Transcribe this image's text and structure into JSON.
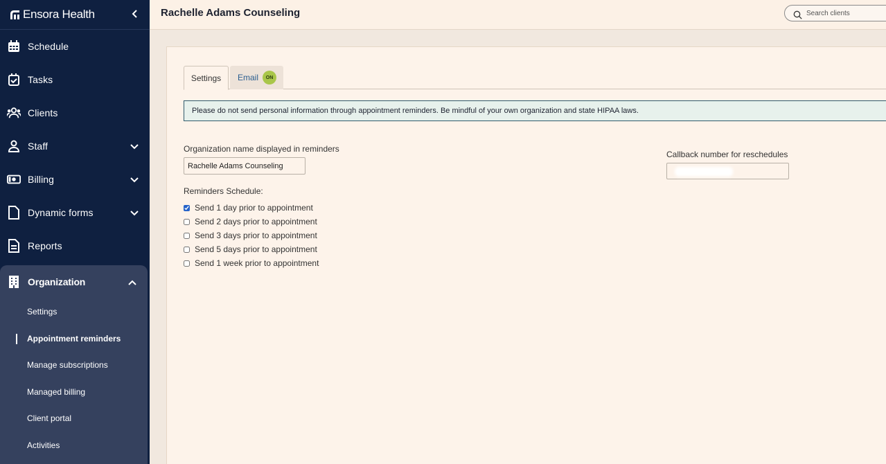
{
  "brand": {
    "name": "Ensora Health"
  },
  "nav": {
    "items": [
      {
        "label": "Schedule",
        "icon": "calendar-icon",
        "has_chevron": false
      },
      {
        "label": "Tasks",
        "icon": "task-check-icon",
        "has_chevron": false
      },
      {
        "label": "Clients",
        "icon": "clients-icon",
        "has_chevron": false
      },
      {
        "label": "Staff",
        "icon": "staff-icon",
        "has_chevron": true
      },
      {
        "label": "Billing",
        "icon": "billing-icon",
        "has_chevron": true
      },
      {
        "label": "Dynamic forms",
        "icon": "form-icon",
        "has_chevron": true
      },
      {
        "label": "Reports",
        "icon": "report-icon",
        "has_chevron": false
      }
    ],
    "organization": {
      "label": "Organization",
      "icon": "building-icon",
      "expanded": true,
      "sub_items": [
        {
          "label": "Settings",
          "active": false
        },
        {
          "label": "Appointment reminders",
          "active": true
        },
        {
          "label": "Manage subscriptions",
          "active": false
        },
        {
          "label": "Managed billing",
          "active": false
        },
        {
          "label": "Client portal",
          "active": false
        },
        {
          "label": "Activities",
          "active": false
        }
      ]
    }
  },
  "header": {
    "title": "Rachelle Adams Counseling",
    "search_placeholder": "Search clients"
  },
  "tabs": {
    "settings": "Settings",
    "email": "Email",
    "email_badge": "ON"
  },
  "notice": "Please do not send personal information through appointment reminders. Be mindful of your own organization and state HIPAA laws.",
  "form": {
    "org_name_label": "Organization name displayed in reminders",
    "org_name_value": "Rachelle Adams Counseling",
    "callback_label": "Callback number for reschedules",
    "callback_value": "",
    "schedule_label": "Reminders Schedule:",
    "schedule_options": [
      {
        "label": "Send 1 day prior to appointment",
        "checked": true
      },
      {
        "label": "Send 2 days prior to appointment",
        "checked": false
      },
      {
        "label": "Send 3 days prior to appointment",
        "checked": false
      },
      {
        "label": "Send 5 days prior to appointment",
        "checked": false
      },
      {
        "label": "Send 1 week prior to appointment",
        "checked": false
      }
    ]
  },
  "colors": {
    "sidebar": "#0f2040",
    "sidebar_group": "#35415e",
    "header": "#fcf1e6",
    "panel": "#fdf3ea",
    "badge": "#a9c64a",
    "notice_border": "#2f5a6b",
    "checkbox_accent": "#2563c9"
  }
}
